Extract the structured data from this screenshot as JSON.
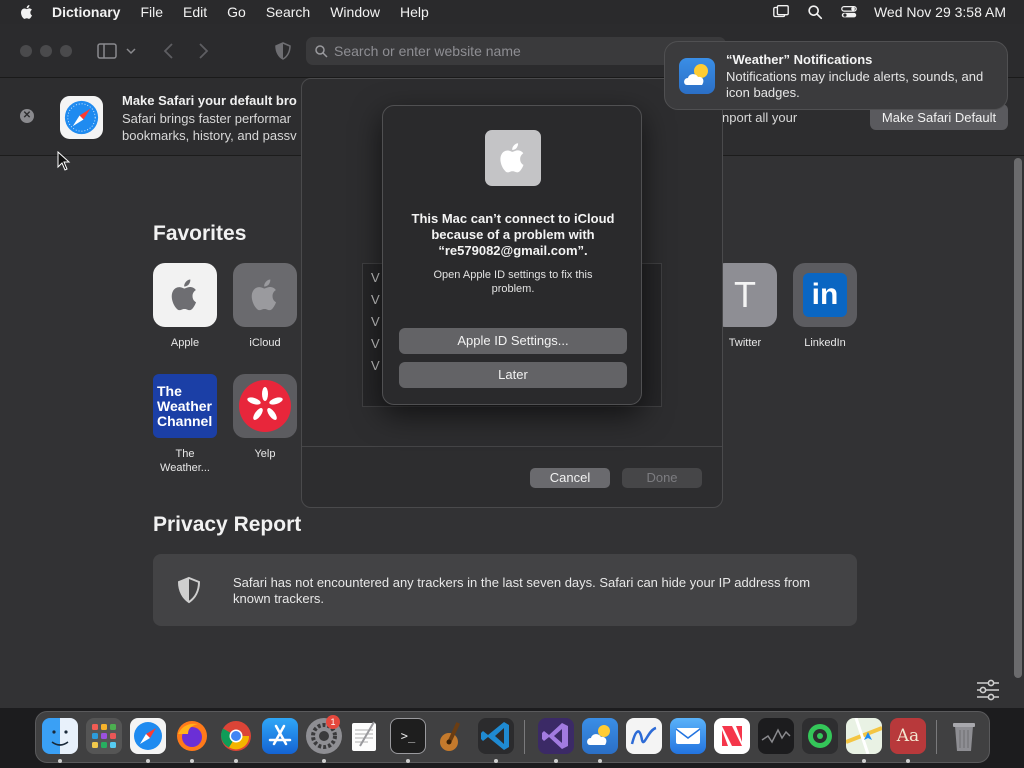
{
  "menubar": {
    "app_name": "Dictionary",
    "menus": [
      "File",
      "Edit",
      "Go",
      "Search",
      "Window",
      "Help"
    ],
    "clock": "Wed Nov 29  3:58 AM"
  },
  "toolbar": {
    "address_placeholder": "Search or enter website name"
  },
  "banner": {
    "title": "Make Safari your default bro",
    "desc_line1": "Safari brings faster performar",
    "desc_line2": "bookmarks, history, and passv",
    "desc_right": "nport all your",
    "button": "Make Safari Default"
  },
  "favorites": {
    "title": "Favorites",
    "items": [
      {
        "label": "Apple"
      },
      {
        "label": "iCloud"
      },
      {
        "label": "Twitter",
        "letter": "T"
      },
      {
        "label": "LinkedIn",
        "letter": "in"
      },
      {
        "label": "The Weather...",
        "tile_text": "The Weather Channel"
      },
      {
        "label": "Yelp"
      }
    ]
  },
  "privacy": {
    "title": "Privacy Report",
    "text": "Safari has not encountered any trackers in the last seven days. Safari can hide your IP address from known trackers."
  },
  "sheet": {
    "list_items": [
      "V",
      "V",
      "V",
      "V",
      "V"
    ],
    "cancel": "Cancel",
    "done": "Done"
  },
  "alert": {
    "heading": "This Mac can’t connect to iCloud because of a problem with “re579082@gmail.com”.",
    "message": "Open Apple ID settings to fix this problem.",
    "primary_button": "Apple ID Settings...",
    "secondary_button": "Later"
  },
  "notification": {
    "title": "“Weather” Notifications",
    "body": "Notifications may include alerts, sounds, and icon badges."
  },
  "dock": {
    "settings_badge": "1",
    "dictionary_glyph": "Aa",
    "terminal_glyph": ">_"
  }
}
